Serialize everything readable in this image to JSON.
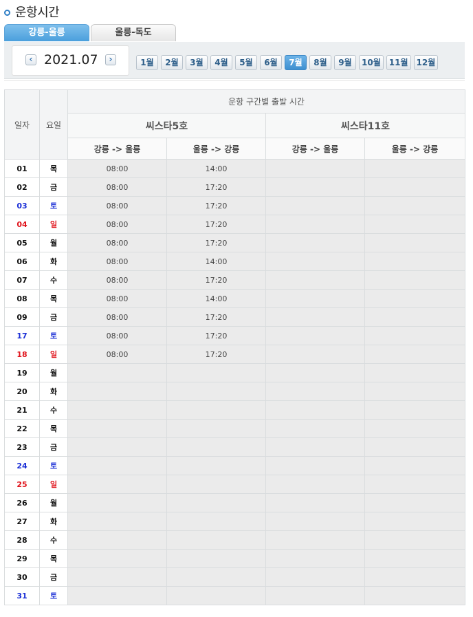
{
  "page": {
    "title": "운항시간"
  },
  "tabs": [
    {
      "label": "강릉-울릉",
      "active": true
    },
    {
      "label": "울릉-독도",
      "active": false
    }
  ],
  "date_nav": {
    "prev_icon": "chevron-left-icon",
    "next_icon": "chevron-right-icon",
    "prev_glyph": "‹",
    "next_glyph": "›",
    "current": "2021.07"
  },
  "months": [
    "1월",
    "2월",
    "3월",
    "4월",
    "5월",
    "6월",
    "7월",
    "8월",
    "9월",
    "10월",
    "11월",
    "12월"
  ],
  "active_month_index": 6,
  "table": {
    "col_day": "일자",
    "col_weekday": "요일",
    "group_header": "운항 구간별 출발 시간",
    "ships": [
      "씨스타5호",
      "씨스타11호"
    ],
    "directions": [
      "강릉 -> 울릉",
      "울릉 -> 강릉",
      "강릉 -> 울릉",
      "울릉 -> 강릉"
    ],
    "rows": [
      {
        "day": "01",
        "wd": "목",
        "t": [
          "08:00",
          "14:00",
          "",
          ""
        ]
      },
      {
        "day": "02",
        "wd": "금",
        "t": [
          "08:00",
          "17:20",
          "",
          ""
        ]
      },
      {
        "day": "03",
        "wd": "토",
        "t": [
          "08:00",
          "17:20",
          "",
          ""
        ]
      },
      {
        "day": "04",
        "wd": "일",
        "t": [
          "08:00",
          "17:20",
          "",
          ""
        ]
      },
      {
        "day": "05",
        "wd": "월",
        "t": [
          "08:00",
          "17:20",
          "",
          ""
        ]
      },
      {
        "day": "06",
        "wd": "화",
        "t": [
          "08:00",
          "14:00",
          "",
          ""
        ]
      },
      {
        "day": "07",
        "wd": "수",
        "t": [
          "08:00",
          "17:20",
          "",
          ""
        ]
      },
      {
        "day": "08",
        "wd": "목",
        "t": [
          "08:00",
          "14:00",
          "",
          ""
        ]
      },
      {
        "day": "09",
        "wd": "금",
        "t": [
          "08:00",
          "17:20",
          "",
          ""
        ]
      },
      {
        "day": "17",
        "wd": "토",
        "t": [
          "08:00",
          "17:20",
          "",
          ""
        ]
      },
      {
        "day": "18",
        "wd": "일",
        "t": [
          "08:00",
          "17:20",
          "",
          ""
        ]
      },
      {
        "day": "19",
        "wd": "월",
        "t": [
          "",
          "",
          "",
          ""
        ]
      },
      {
        "day": "20",
        "wd": "화",
        "t": [
          "",
          "",
          "",
          ""
        ]
      },
      {
        "day": "21",
        "wd": "수",
        "t": [
          "",
          "",
          "",
          ""
        ]
      },
      {
        "day": "22",
        "wd": "목",
        "t": [
          "",
          "",
          "",
          ""
        ]
      },
      {
        "day": "23",
        "wd": "금",
        "t": [
          "",
          "",
          "",
          ""
        ]
      },
      {
        "day": "24",
        "wd": "토",
        "t": [
          "",
          "",
          "",
          ""
        ]
      },
      {
        "day": "25",
        "wd": "일",
        "t": [
          "",
          "",
          "",
          ""
        ]
      },
      {
        "day": "26",
        "wd": "월",
        "t": [
          "",
          "",
          "",
          ""
        ]
      },
      {
        "day": "27",
        "wd": "화",
        "t": [
          "",
          "",
          "",
          ""
        ]
      },
      {
        "day": "28",
        "wd": "수",
        "t": [
          "",
          "",
          "",
          ""
        ]
      },
      {
        "day": "29",
        "wd": "목",
        "t": [
          "",
          "",
          "",
          ""
        ]
      },
      {
        "day": "30",
        "wd": "금",
        "t": [
          "",
          "",
          "",
          ""
        ]
      },
      {
        "day": "31",
        "wd": "토",
        "t": [
          "",
          "",
          "",
          ""
        ]
      }
    ]
  },
  "colors": {
    "accent": "#4a9fdc",
    "saturday": "#1b2fd6",
    "sunday": "#e0141c",
    "cell_bg": "#ebebeb"
  }
}
